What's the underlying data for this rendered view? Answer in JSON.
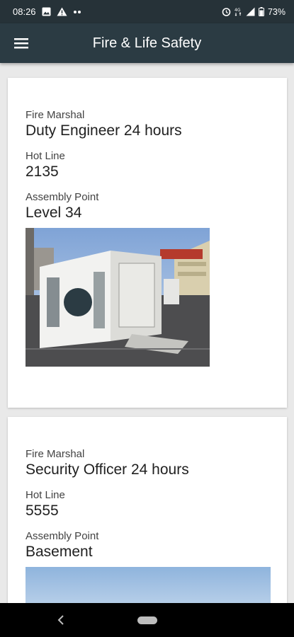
{
  "status_bar": {
    "time": "08:26",
    "battery": "73%",
    "icons_left": [
      "image-icon",
      "warning-icon",
      "more-dots-icon"
    ],
    "icons_right": [
      "alarm-icon",
      "signal-4g-icon",
      "cell-signal-icon",
      "battery-icon"
    ]
  },
  "app_bar": {
    "title": "Fire & Life Safety",
    "menu_icon": "hamburger-menu-icon"
  },
  "cards": [
    {
      "fire_marshal_label": "Fire Marshal",
      "fire_marshal_value": "Duty Engineer 24 hours",
      "hot_line_label": "Hot Line",
      "hot_line_value": "2135",
      "assembly_point_label": "Assembly Point",
      "assembly_point_value": "Level 34"
    },
    {
      "fire_marshal_label": "Fire Marshal",
      "fire_marshal_value": "Security Officer 24 hours",
      "hot_line_label": "Hot Line",
      "hot_line_value": "5555",
      "assembly_point_label": "Assembly Point",
      "assembly_point_value": "Basement"
    }
  ],
  "colors": {
    "status_bar": "#263238",
    "app_bar": "#2b3b43",
    "background": "#e9e9e9",
    "card": "#ffffff"
  }
}
